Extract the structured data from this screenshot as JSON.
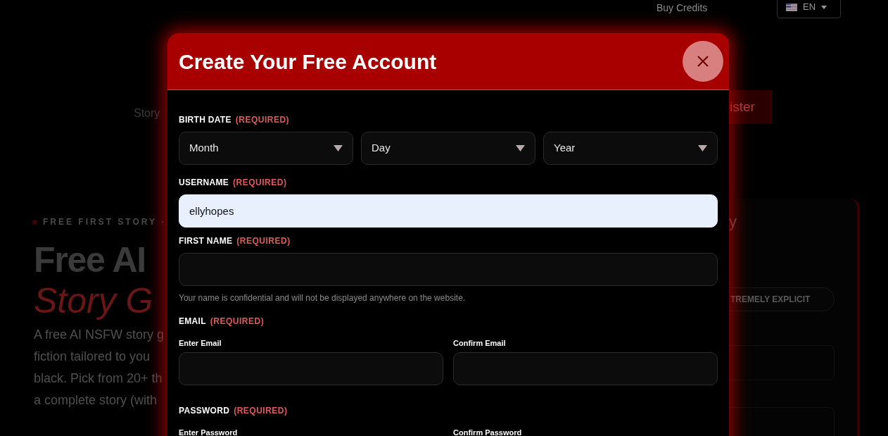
{
  "background": {
    "buy_credits": "Buy Credits",
    "language": "EN",
    "nav_item": "Story",
    "register_button": "ister",
    "hero": {
      "eyebrow": "FREE FIRST STORY ·",
      "title_line_1": "Free AI",
      "title_line_2": "Story G",
      "paragraph_lines": [
        "A free AI NSFW story g",
        "fiction tailored to you",
        "black. Pick from 20+ th",
        "a complete story (with"
      ]
    },
    "side_card": {
      "heading": "y",
      "chip": "TREMELY EXPLICIT"
    }
  },
  "modal": {
    "title": "Create Your Free Account",
    "sections": [
      {
        "kind": "selects",
        "label": "BIRTH DATE",
        "required": "(REQUIRED)",
        "selects": [
          "Month",
          "Day",
          "Year"
        ]
      },
      {
        "kind": "input",
        "label": "USERNAME",
        "required": "(REQUIRED)",
        "value": "ellyhopes",
        "autofilled": true
      },
      {
        "kind": "input",
        "label": "FIRST NAME",
        "required": "(REQUIRED)",
        "autofilled": false,
        "note": "Your name is confidential and will not be displayed anywhere on the website."
      },
      {
        "kind": "pair",
        "label": "EMAIL",
        "required": "(REQUIRED)",
        "fields": [
          "Enter Email",
          "Confirm Email"
        ]
      },
      {
        "kind": "pair_cut",
        "label": "PASSWORD",
        "required": "(REQUIRED)",
        "fields": [
          "Enter Password",
          "Confirm Password"
        ]
      }
    ]
  }
}
